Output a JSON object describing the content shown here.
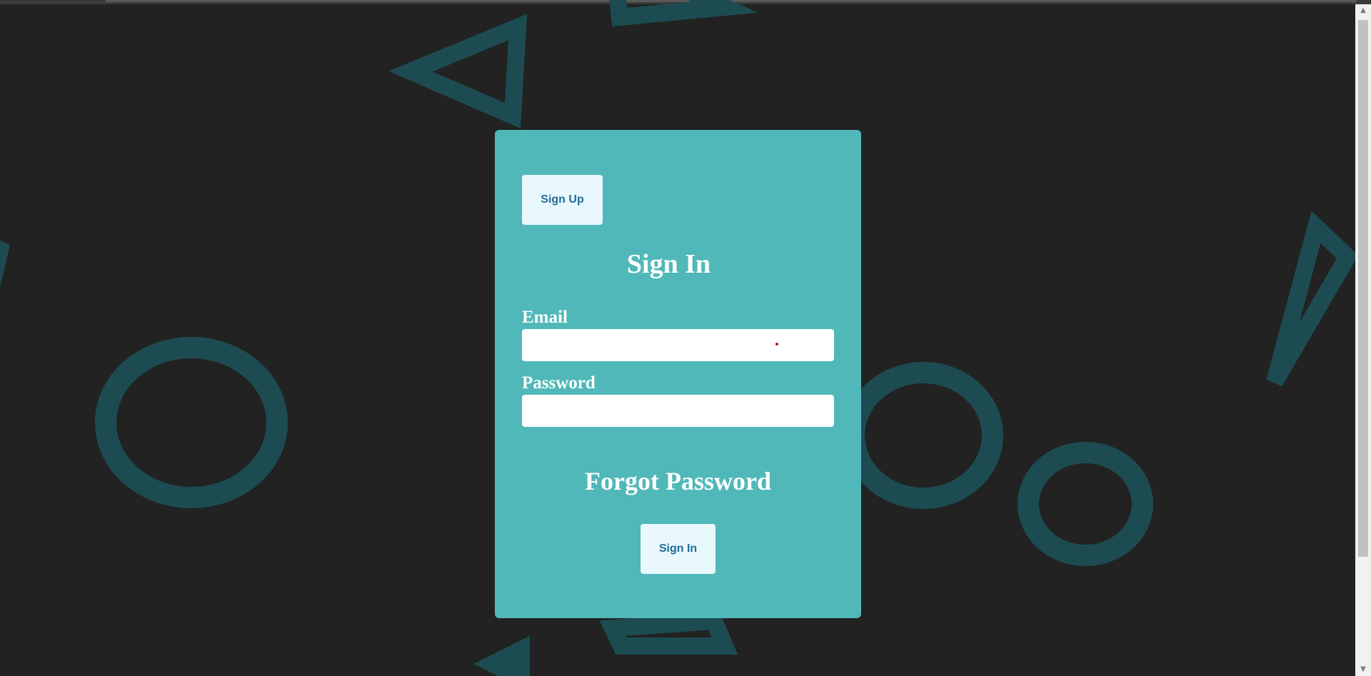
{
  "form": {
    "signup_label": "Sign Up",
    "title": "Sign In",
    "email_label": "Email",
    "email_value": "",
    "password_label": "Password",
    "password_value": "",
    "forgot_label": "Forgot Password",
    "signin_label": "Sign In"
  },
  "colors": {
    "page_background": "#222222",
    "card_background": "#50b8b8",
    "button_background": "#e8f8fd",
    "button_text": "#1f6c98",
    "decor_shapes": "#1c4c52"
  },
  "decor_icons": [
    "triangle-icon",
    "circle-icon"
  ]
}
